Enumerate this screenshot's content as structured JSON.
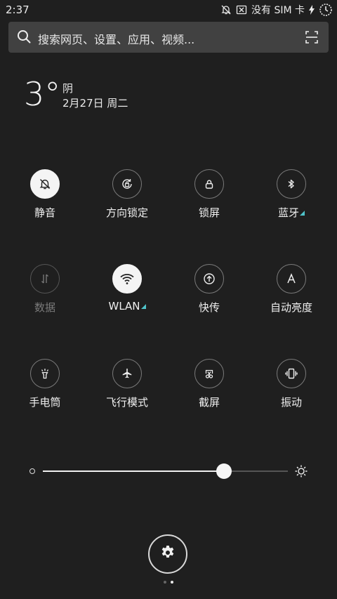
{
  "status_bar": {
    "time": "2:37",
    "carrier": "没有 SIM 卡",
    "icons": [
      "bell-off-icon",
      "sim-x-icon",
      "charging-icon",
      "battery-icon"
    ]
  },
  "search": {
    "placeholder": "搜索网页、设置、应用、视频...",
    "icons": [
      "search-icon",
      "scan-icon"
    ]
  },
  "weather": {
    "temperature": "3°",
    "condition": "阴",
    "date": "2月27日 周二"
  },
  "tiles": [
    {
      "label": "静音",
      "icon": "bell-off-icon",
      "state": "on"
    },
    {
      "label": "方向锁定",
      "icon": "rotation-lock-icon",
      "state": "off"
    },
    {
      "label": "锁屏",
      "icon": "lock-icon",
      "state": "off"
    },
    {
      "label": "蓝牙",
      "icon": "bluetooth-icon",
      "state": "off",
      "has_more": true
    },
    {
      "label": "数据",
      "icon": "mobile-data-icon",
      "state": "disabled"
    },
    {
      "label": "WLAN",
      "icon": "wifi-icon",
      "state": "on",
      "has_more": true
    },
    {
      "label": "快传",
      "icon": "quick-transfer-icon",
      "state": "off"
    },
    {
      "label": "自动亮度",
      "icon": "auto-brightness-icon",
      "state": "off"
    },
    {
      "label": "手电筒",
      "icon": "flashlight-icon",
      "state": "off"
    },
    {
      "label": "飞行模式",
      "icon": "airplane-icon",
      "state": "off"
    },
    {
      "label": "截屏",
      "icon": "screenshot-icon",
      "state": "off"
    },
    {
      "label": "振动",
      "icon": "vibrate-icon",
      "state": "off"
    }
  ],
  "brightness": {
    "level": 0.74,
    "icons": [
      "brightness-low-icon",
      "sun-icon"
    ]
  },
  "settings": {
    "icon": "gear-icon"
  },
  "pager": {
    "pages": 2,
    "current": 2
  },
  "colors": {
    "background": "#1f1f1f",
    "accent_indicator": "#4fc3c9",
    "active_tile": "#f4f4f4"
  }
}
